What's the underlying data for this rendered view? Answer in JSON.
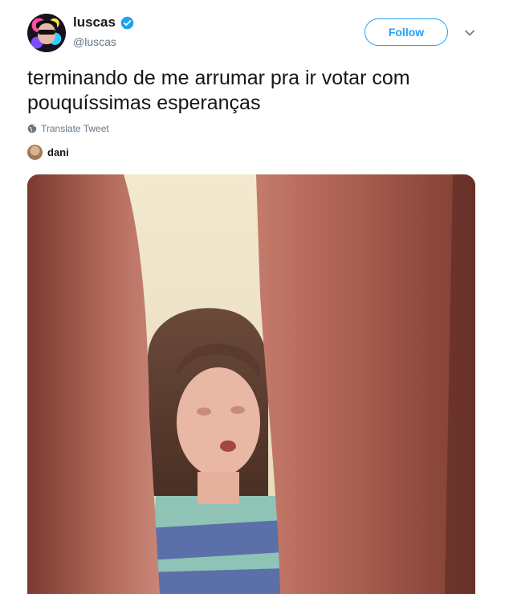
{
  "tweet": {
    "author": {
      "name": "luscas",
      "handle": "@luscas",
      "verified": true
    },
    "follow_label": "Follow",
    "text": "terminando de me arrumar pra ir votar com pouquíssimas esperanças",
    "translate_label": "Translate Tweet",
    "tagged_user": "dani",
    "media_description": "video-still"
  },
  "colors": {
    "accent": "#1da1f2",
    "text": "#14171a",
    "muted": "#657786"
  },
  "icons": {
    "verified": "verified-badge-icon",
    "menu": "chevron-down-icon",
    "translate": "globe-icon"
  }
}
